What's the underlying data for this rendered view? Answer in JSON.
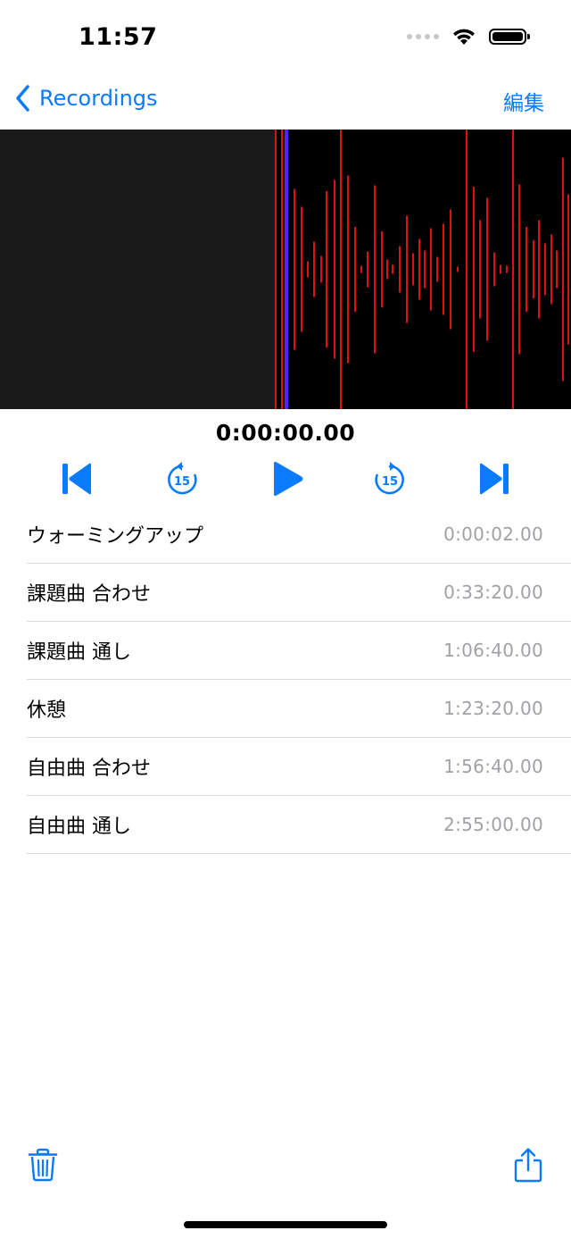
{
  "status_bar": {
    "time": "11:57"
  },
  "nav": {
    "back_label": "Recordings",
    "edit_label": "編集"
  },
  "player": {
    "elapsed": "0:00:00.00",
    "skip_back_seconds": "15",
    "skip_forward_seconds": "15"
  },
  "colors": {
    "accent": "#0a7aff",
    "waveform_bg": "#000000",
    "waveform_left_panel": "#1a1a1a",
    "waveform_bars": "#e01010",
    "playhead": "#5522ff",
    "secondary_text": "#a1a1a6"
  },
  "chapters": [
    {
      "title": "ウォーミングアップ",
      "time": "0:00:02.00"
    },
    {
      "title": "課題曲 合わせ",
      "time": "0:33:20.00"
    },
    {
      "title": "課題曲 通し",
      "time": "1:06:40.00"
    },
    {
      "title": "休憩",
      "time": "1:23:20.00"
    },
    {
      "title": "自由曲 合わせ",
      "time": "1:56:40.00"
    },
    {
      "title": "自由曲 通し",
      "time": "2:55:00.00"
    }
  ],
  "toolbar": {
    "left_icon": "trash-icon",
    "right_icon": "share-icon"
  }
}
